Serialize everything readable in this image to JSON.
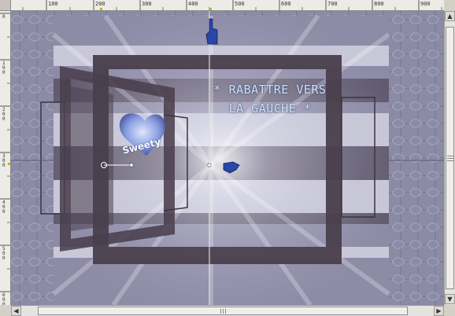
{
  "window": {
    "title": "",
    "ruler_unit": "px"
  },
  "rulers": {
    "horizontal": [
      "100",
      "200",
      "300",
      "400",
      "500",
      "600",
      "700",
      "800",
      "900"
    ],
    "vertical": [
      "0",
      "100",
      "200",
      "300",
      "400",
      "500",
      "600"
    ]
  },
  "canvas": {
    "overlay_line1": "* RABATTRE VERS",
    "overlay_line2": "LA GAUCHE *",
    "heart_label": "Sweety",
    "colors": {
      "background_pattern": "#8f8ea8",
      "frame": "#4a3f4c",
      "stripes": "#c9c8d8",
      "guide": "#cccccc",
      "text_accent": "#cfe2f6"
    },
    "icons": [
      "pointing-hand-top-icon",
      "pointing-hand-center-icon",
      "rotation-handle-icon",
      "heart-watermark-icon"
    ]
  },
  "scrollbars": {
    "vertical": {
      "up_arrow": "▲",
      "down_arrow": "▼",
      "position": 0.47
    },
    "horizontal": {
      "left_arrow": "◀",
      "right_arrow": "▶",
      "position": 0.48
    }
  }
}
